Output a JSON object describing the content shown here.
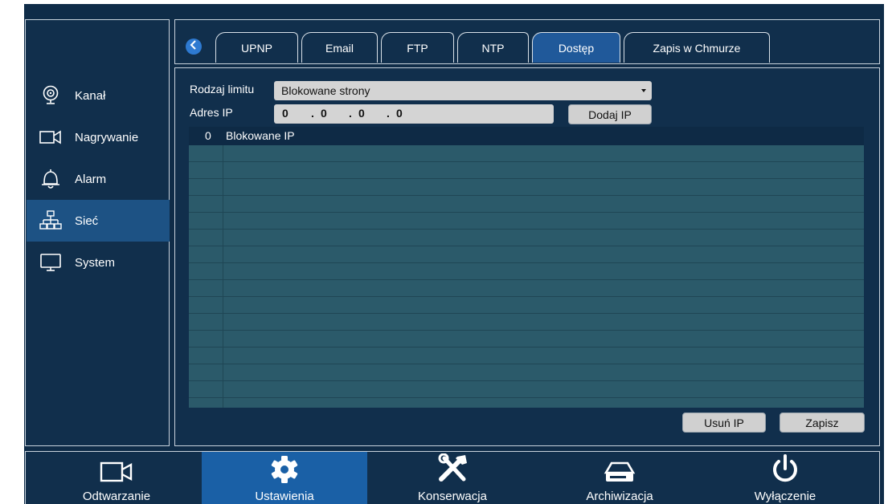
{
  "sidebar": {
    "items": [
      {
        "label": "Kanał",
        "icon": "camera-icon",
        "active": false
      },
      {
        "label": "Nagrywanie",
        "icon": "video-camera-icon",
        "active": false
      },
      {
        "label": "Alarm",
        "icon": "bell-icon",
        "active": false
      },
      {
        "label": "Sieć",
        "icon": "network-icon",
        "active": true
      },
      {
        "label": "System",
        "icon": "monitor-icon",
        "active": false
      }
    ]
  },
  "tabs": {
    "back_icon": "chevron-left-icon",
    "items": [
      {
        "label": "UPNP",
        "active": false
      },
      {
        "label": "Email",
        "active": false
      },
      {
        "label": "FTP",
        "active": false
      },
      {
        "label": "NTP",
        "active": false
      },
      {
        "label": "Dostęp",
        "active": true
      },
      {
        "label": "Zapis w Chmurze",
        "active": false
      }
    ]
  },
  "form": {
    "limit_type_label": "Rodzaj limitu",
    "limit_type_value": "Blokowane strony",
    "ip_label": "Adres IP",
    "ip_octets": [
      "0",
      "0",
      "0",
      "0"
    ],
    "ip_dots": [
      ".",
      ".",
      "."
    ],
    "add_ip_button": "Dodaj IP"
  },
  "table": {
    "count": "0",
    "header": "Blokowane IP",
    "rows": []
  },
  "actions": {
    "remove_ip": "Usuń IP",
    "save": "Zapisz"
  },
  "bottom_nav": {
    "items": [
      {
        "label": "Odtwarzanie",
        "icon": "video-camera-icon",
        "active": false
      },
      {
        "label": "Ustawienia",
        "icon": "gear-icon",
        "active": true
      },
      {
        "label": "Konserwacja",
        "icon": "tools-icon",
        "active": false
      },
      {
        "label": "Archiwizacja",
        "icon": "archive-drive-icon",
        "active": false
      },
      {
        "label": "Wyłączenie",
        "icon": "power-icon",
        "active": false
      }
    ]
  },
  "colors": {
    "background": "#112f4c",
    "active": "#1d5284",
    "accent": "#2e7ad1",
    "table_body": "#2b5a6a"
  }
}
